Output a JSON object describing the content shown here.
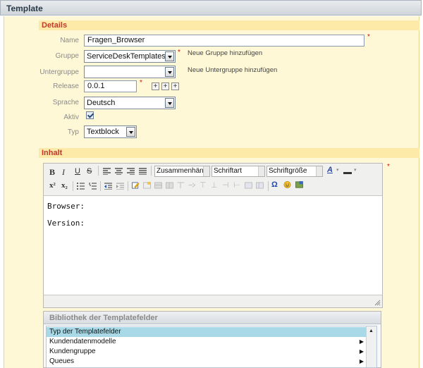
{
  "window": {
    "title": "Template"
  },
  "details": {
    "heading": "Details",
    "name_label": "Name",
    "name_value": "Fragen_Browser",
    "gruppe_label": "Gruppe",
    "gruppe_value": "ServiceDeskTemplates",
    "gruppe_hint": "Neue Gruppe hinzufügen",
    "untergruppe_label": "Untergruppe",
    "untergruppe_value": "",
    "untergruppe_hint": "Neue Untergruppe hinzufügen",
    "release_label": "Release",
    "release_value": "0.0.1",
    "release_plus": "+",
    "sprache_label": "Sprache",
    "sprache_value": "Deutsch",
    "aktiv_label": "Aktiv",
    "typ_label": "Typ",
    "typ_value": "Textblock",
    "required_mark": "*"
  },
  "inhalt": {
    "heading": "Inhalt",
    "toolbar": {
      "bold": "B",
      "italic": "I",
      "underline": "U",
      "strike": "S",
      "format_value": "Zusammenhäng",
      "font_value": "Schriftart",
      "size_value": "Schriftgröße",
      "textcolor": "A",
      "superscript": "x²",
      "subscript": "x₂",
      "special_char": "Ω"
    },
    "lines": [
      "Browser:",
      "Version:"
    ]
  },
  "library": {
    "title": "Bibliothek der Templatefelder",
    "items": [
      {
        "label": "Typ der Templatefelder",
        "selected": true
      },
      {
        "label": "Kundendatenmodelle",
        "selected": false
      },
      {
        "label": "Kundengruppe",
        "selected": false
      },
      {
        "label": "Queues",
        "selected": false
      }
    ]
  },
  "colors": {
    "panel_bg": "#fff8d6",
    "section_heading": "#c0392b",
    "selected_row": "#a9d9e6",
    "required": "#d01010"
  }
}
